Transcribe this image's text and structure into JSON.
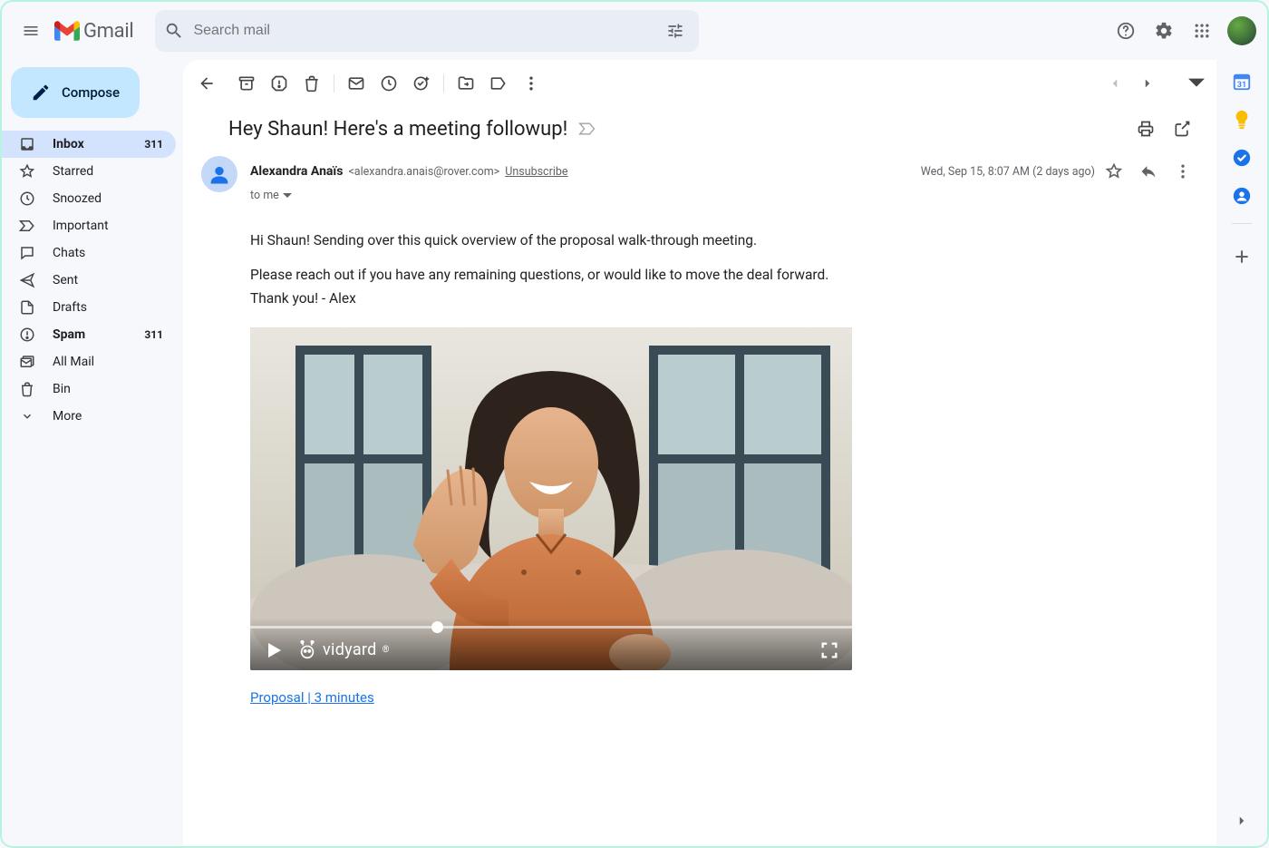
{
  "header": {
    "app_name": "Gmail",
    "search_placeholder": "Search mail"
  },
  "compose_label": "Compose",
  "nav": [
    {
      "icon": "inbox",
      "label": "Inbox",
      "count": "311",
      "active": true,
      "bold": true
    },
    {
      "icon": "star",
      "label": "Starred",
      "count": "",
      "active": false,
      "bold": false
    },
    {
      "icon": "clock",
      "label": "Snoozed",
      "count": "",
      "active": false,
      "bold": false
    },
    {
      "icon": "important",
      "label": "Important",
      "count": "",
      "active": false,
      "bold": false
    },
    {
      "icon": "chat",
      "label": "Chats",
      "count": "",
      "active": false,
      "bold": false
    },
    {
      "icon": "send",
      "label": "Sent",
      "count": "",
      "active": false,
      "bold": false
    },
    {
      "icon": "draft",
      "label": "Drafts",
      "count": "",
      "active": false,
      "bold": false
    },
    {
      "icon": "spam",
      "label": "Spam",
      "count": "311",
      "active": false,
      "bold": true
    },
    {
      "icon": "allmail",
      "label": "All Mail",
      "count": "",
      "active": false,
      "bold": false
    },
    {
      "icon": "bin",
      "label": "Bin",
      "count": "",
      "active": false,
      "bold": false
    },
    {
      "icon": "more",
      "label": "More",
      "count": "",
      "active": false,
      "bold": false
    }
  ],
  "email": {
    "subject": "Hey Shaun! Here's a meeting followup!",
    "from_name": "Alexandra Anaïs",
    "from_addr": "<alexandra.anais@rover.com>",
    "unsubscribe": "Unsubscribe",
    "to_line": "to me",
    "date": "Wed, Sep 15, 8:07 AM (2 days ago)",
    "body": {
      "p1": "Hi Shaun! Sending over this quick overview of the proposal walk-through meeting.",
      "p2": "Please reach out if you have any remaining questions, or would like to move the deal forward.",
      "p3": "Thank you! - Alex"
    },
    "video_brand": "vidyard",
    "video_link": "Proposal | 3 minutes",
    "video_progress_pct": 31
  }
}
